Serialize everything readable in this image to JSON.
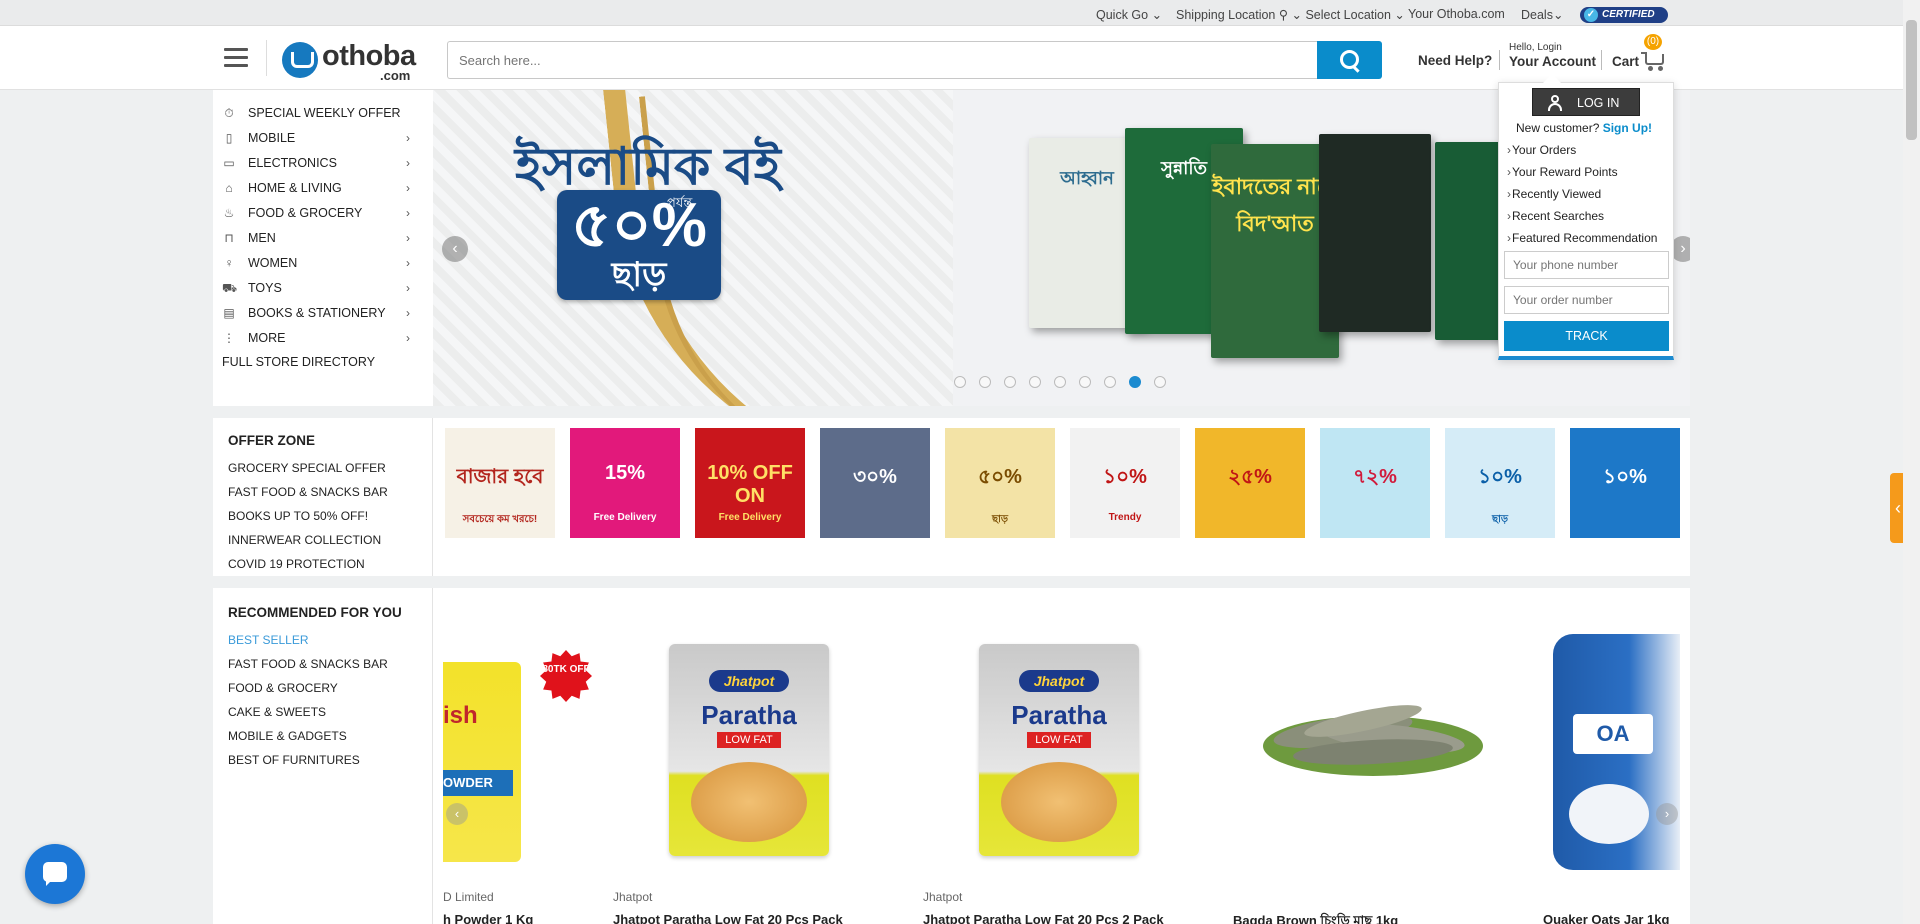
{
  "topbar": {
    "quick_go": "Quick Go",
    "shipping_location": "Shipping Location",
    "select_location": "Select Location",
    "your_othoba": "Your Othoba.com",
    "deals": "Deals",
    "certified": "CERTIFIED"
  },
  "header": {
    "logo_text": "othoba",
    "logo_suffix": ".com",
    "search_placeholder": "Search here...",
    "need_help": "Need Help?",
    "hello_login": "Hello, Login",
    "your_account": "Your Account",
    "cart": "Cart",
    "cart_count": "(0)"
  },
  "sidemenu": {
    "items": [
      {
        "label": "SPECIAL WEEKLY OFFER",
        "icon": "stopwatch-icon",
        "has_arrow": false
      },
      {
        "label": "MOBILE",
        "icon": "mobile-icon",
        "has_arrow": true
      },
      {
        "label": "ELECTRONICS",
        "icon": "electronics-icon",
        "has_arrow": true
      },
      {
        "label": "HOME & LIVING",
        "icon": "home-icon",
        "has_arrow": true
      },
      {
        "label": "FOOD & GROCERY",
        "icon": "food-icon",
        "has_arrow": true
      },
      {
        "label": "MEN",
        "icon": "shirt-icon",
        "has_arrow": true
      },
      {
        "label": "WOMEN",
        "icon": "women-icon",
        "has_arrow": true
      },
      {
        "label": "TOYS",
        "icon": "toy-car-icon",
        "has_arrow": true
      },
      {
        "label": "BOOKS & STATIONERY",
        "icon": "book-icon",
        "has_arrow": true
      },
      {
        "label": "MORE",
        "icon": "more-icon",
        "has_arrow": true
      }
    ],
    "arrow": "›",
    "full_store": "FULL STORE DIRECTORY"
  },
  "banner": {
    "title": "ইসলামিক বই",
    "badge_small": "পর্যন্ত",
    "badge_percent": "৫০%",
    "badge_word": "ছাড়",
    "active_slide": 8,
    "slide_count": 9,
    "books": [
      "আহ্বান",
      "সুন্নাতি",
      "ইবাদতের নামে বিদ'আত",
      "",
      ""
    ]
  },
  "account_dropdown": {
    "login": "LOG IN",
    "new_customer": "New customer?",
    "sign_up": "Sign Up!",
    "links": [
      "Your Orders",
      "Your Reward Points",
      "Recently Viewed",
      "Recent Searches",
      "Featured Recommendation"
    ],
    "phone_placeholder": "Your phone number",
    "order_placeholder": "Your order number",
    "track": "TRACK"
  },
  "offer_zone": {
    "title": "OFFER ZONE",
    "links": [
      "GROCERY SPECIAL OFFER",
      "FAST FOOD & SNACKS BAR",
      "BOOKS UP TO 50% OFF!",
      "INNERWEAR COLLECTION",
      "COVID 19 PROTECTION"
    ],
    "tiles": [
      {
        "t1": "বাজার হবে",
        "t2": "সবচেয়ে কম খরচে!",
        "bg": "#f6f1e6",
        "fg": "#b3261e"
      },
      {
        "t1": "15%",
        "t2": "Free Delivery",
        "bg": "#e2197b",
        "fg": "#ffffff"
      },
      {
        "t1": "10% OFF ON",
        "t2": "Free Delivery",
        "bg": "#c9161c",
        "fg": "#ffe066"
      },
      {
        "t1": "৩০%",
        "t2": "",
        "bg": "#5d6c8a",
        "fg": "#ffffff"
      },
      {
        "t1": "৫০%",
        "t2": "ছাড়",
        "bg": "#f3e3a6",
        "fg": "#7a4c00"
      },
      {
        "t1": "১০%",
        "t2": "Trendy",
        "bg": "#f2f2f2",
        "fg": "#c01515"
      },
      {
        "t1": "২৫%",
        "t2": "",
        "bg": "#f1b72a",
        "fg": "#c01515"
      },
      {
        "t1": "৭২%",
        "t2": "",
        "bg": "#bfe6f3",
        "fg": "#d11b3b"
      },
      {
        "t1": "১০%",
        "t2": "ছাড়",
        "bg": "#d5ecf7",
        "fg": "#0a5fa8"
      },
      {
        "t1": "১০%",
        "t2": "",
        "bg": "#1d78c8",
        "fg": "#ffffff"
      }
    ]
  },
  "recommended": {
    "title": "RECOMMENDED FOR YOU",
    "links": [
      "BEST SELLER",
      "FAST FOOD & SNACKS BAR",
      "FOOD & GROCERY",
      "CAKE & SWEETS",
      "MOBILE & GADGETS",
      "BEST OF FURNITURES"
    ],
    "active_link": "BEST SELLER",
    "products": [
      {
        "vendor": "D Limited",
        "name": "h Powder 1 Kg",
        "badge": "80TK OFF",
        "kind": "powder"
      },
      {
        "vendor": "Jhatpot",
        "name": "Jhatpot Paratha Low Fat 20 Pcs Pack",
        "kind": "paratha"
      },
      {
        "vendor": "Jhatpot",
        "name": "Jhatpot Paratha Low Fat 20 Pcs 2 Pack",
        "kind": "paratha"
      },
      {
        "vendor": "",
        "name": "Bagda Brown চিংড়ি মাছ 1kg",
        "kind": "shrimp"
      },
      {
        "vendor": "",
        "name": "Quaker Oats Jar 1kg",
        "kind": "oats"
      }
    ],
    "paratha_brand": "Jhatpot",
    "paratha_name": "Paratha",
    "paratha_tag": "LOW FAT"
  },
  "colors": {
    "accent": "#0a8ccb",
    "cart_badge": "#f5a300",
    "side_tab": "#f59a1b"
  }
}
